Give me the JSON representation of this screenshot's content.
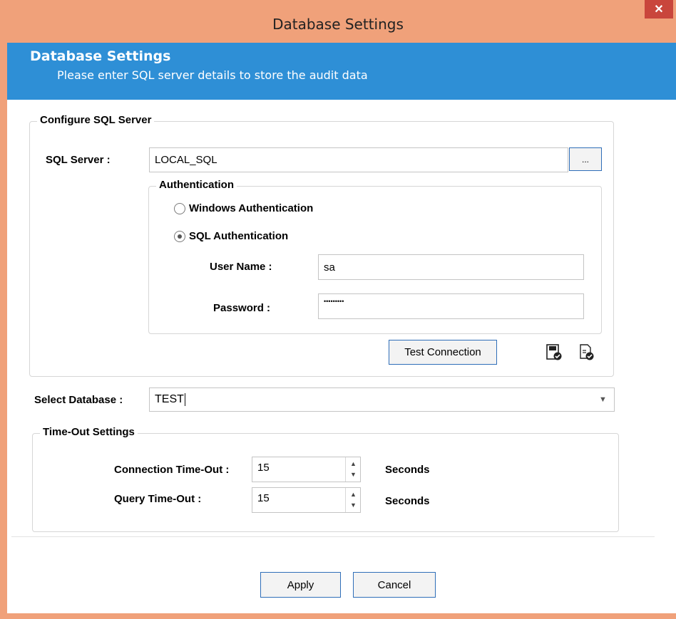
{
  "window": {
    "title": "Database Settings",
    "close_label": "✕"
  },
  "banner": {
    "title": "Database Settings",
    "subtitle": "Please enter SQL server details to store the audit data"
  },
  "sql_group": {
    "legend": "Configure SQL Server",
    "server_label": "SQL Server :",
    "server_value": "LOCAL_SQL",
    "browse_label": "...",
    "auth": {
      "legend": "Authentication",
      "windows_label": "Windows Authentication",
      "sql_label": "SQL Authentication",
      "selected": "sql",
      "username_label": "User Name :",
      "username_value": "sa",
      "password_label": "Password  :",
      "password_value": "•••••••••"
    },
    "test_connection_label": "Test Connection",
    "icons": [
      "save-check-icon",
      "document-check-icon"
    ]
  },
  "database": {
    "label": "Select Database :",
    "value": "TEST"
  },
  "timeout_group": {
    "legend": "Time-Out Settings",
    "connection_label": "Connection Time-Out :",
    "connection_value": "15",
    "query_label": "Query Time-Out :",
    "query_value": "15",
    "unit_label": "Seconds"
  },
  "footer": {
    "apply_label": "Apply",
    "cancel_label": "Cancel"
  },
  "colors": {
    "titlebar": "#f0a17a",
    "banner": "#2e8fd6",
    "close": "#c9463c",
    "button_border": "#2f6eb8"
  }
}
